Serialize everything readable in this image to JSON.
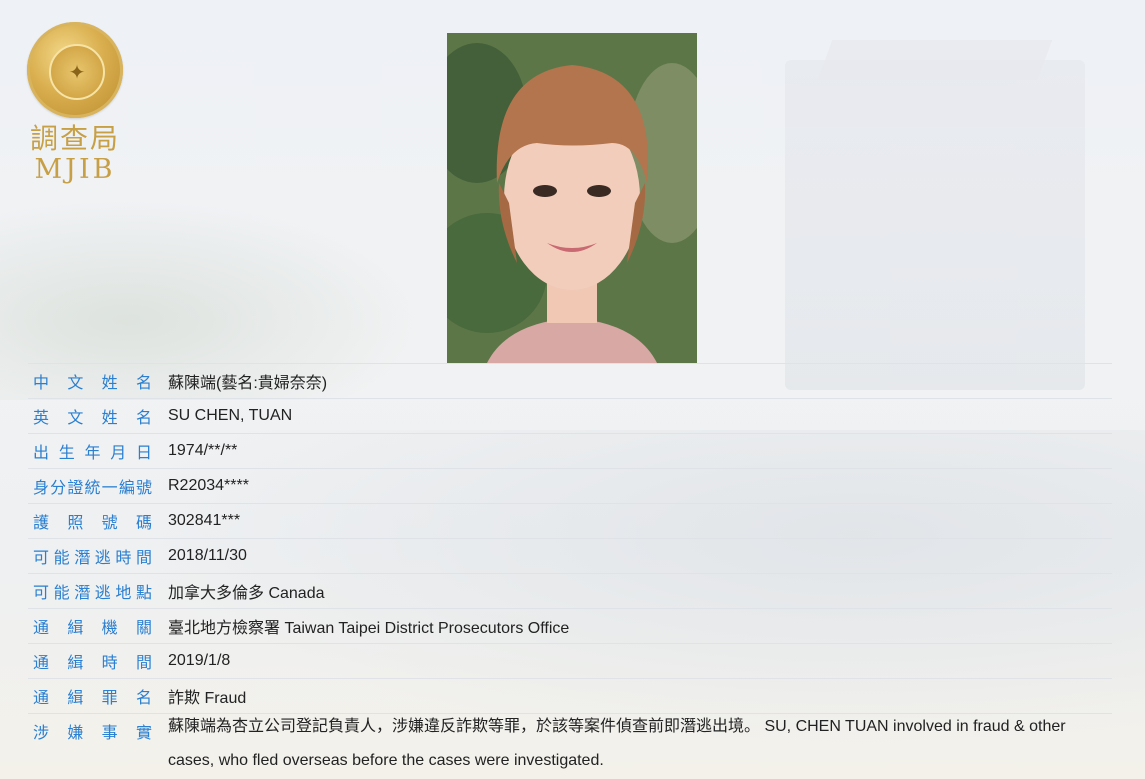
{
  "logo": {
    "chinese": "調查局",
    "english": "MJIB",
    "icon": "mjib-seal"
  },
  "photo": {
    "icon": "person-photo"
  },
  "fields": [
    {
      "label": "中文姓名",
      "value": "蘇陳端(藝名:貴婦奈奈)"
    },
    {
      "label": "英文姓名",
      "value": "SU CHEN, TUAN"
    },
    {
      "label": "出生年月日",
      "value": "1974/**/**"
    },
    {
      "label": "身分證統一編號",
      "value": "R22034****"
    },
    {
      "label": "護照號碼",
      "value": "302841***"
    },
    {
      "label": "可能潛逃時間",
      "value": "2018/11/30"
    },
    {
      "label": "可能潛逃地點",
      "value": "加拿大多倫多 Canada"
    },
    {
      "label": "通緝機關",
      "value": "臺北地方檢察署 Taiwan Taipei District Prosecutors Office"
    },
    {
      "label": "通緝時間",
      "value": "2019/1/8"
    },
    {
      "label": "通緝罪名",
      "value": "詐欺 Fraud"
    },
    {
      "label": "涉嫌事實",
      "value": "蘇陳端為杏立公司登記負責人，涉嫌違反詐欺等罪，於該等案件偵查前即潛逃出境。 SU, CHEN TUAN involved in fraud & other cases, who fled overseas before the cases were investigated."
    }
  ],
  "colors": {
    "label": "#2a7fd0",
    "value": "#222222",
    "gold": "#c79f45"
  }
}
